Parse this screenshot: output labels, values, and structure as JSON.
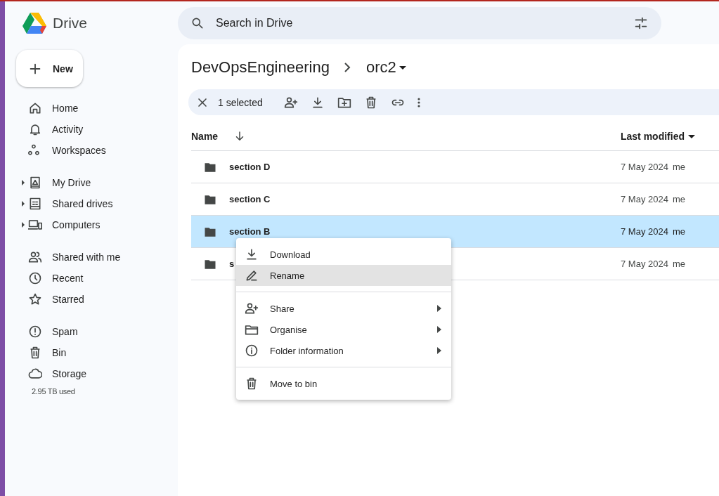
{
  "app": {
    "name": "Drive"
  },
  "search": {
    "placeholder": "Search in Drive"
  },
  "new_button": {
    "label": "New"
  },
  "sidebar": {
    "groups": [
      [
        {
          "label": "Home",
          "expandable": false
        },
        {
          "label": "Activity",
          "expandable": false
        },
        {
          "label": "Workspaces",
          "expandable": false
        }
      ],
      [
        {
          "label": "My Drive",
          "expandable": true
        },
        {
          "label": "Shared drives",
          "expandable": true
        },
        {
          "label": "Computers",
          "expandable": true
        }
      ],
      [
        {
          "label": "Shared with me",
          "expandable": false
        },
        {
          "label": "Recent",
          "expandable": false
        },
        {
          "label": "Starred",
          "expandable": false
        }
      ],
      [
        {
          "label": "Spam",
          "expandable": false
        },
        {
          "label": "Bin",
          "expandable": false
        },
        {
          "label": "Storage",
          "expandable": false
        }
      ]
    ],
    "storage_used": "2.95 TB used"
  },
  "breadcrumb": {
    "parent": "DevOpsEngineering",
    "current": "orc2"
  },
  "selection_bar": {
    "count": "1 selected"
  },
  "table": {
    "columns": [
      {
        "label": "Name"
      },
      {
        "label": "Last modified"
      }
    ],
    "rows": [
      {
        "name": "section D",
        "modified": "7 May 2024",
        "owner": "me",
        "selected": false
      },
      {
        "name": "section C",
        "modified": "7 May 2024",
        "owner": "me",
        "selected": false
      },
      {
        "name": "section B",
        "modified": "7 May 2024",
        "owner": "me",
        "selected": true
      },
      {
        "name": "s",
        "modified": "7 May 2024",
        "owner": "me",
        "selected": false
      }
    ]
  },
  "context_menu": {
    "groups": [
      [
        {
          "label": "Download",
          "submenu": false,
          "selected": false
        },
        {
          "label": "Rename",
          "submenu": false,
          "selected": true
        }
      ],
      [
        {
          "label": "Share",
          "submenu": true,
          "selected": false
        },
        {
          "label": "Organise",
          "submenu": true,
          "selected": false
        },
        {
          "label": "Folder information",
          "submenu": true,
          "selected": false
        }
      ],
      [
        {
          "label": "Move to bin",
          "submenu": false,
          "selected": false
        }
      ]
    ]
  }
}
